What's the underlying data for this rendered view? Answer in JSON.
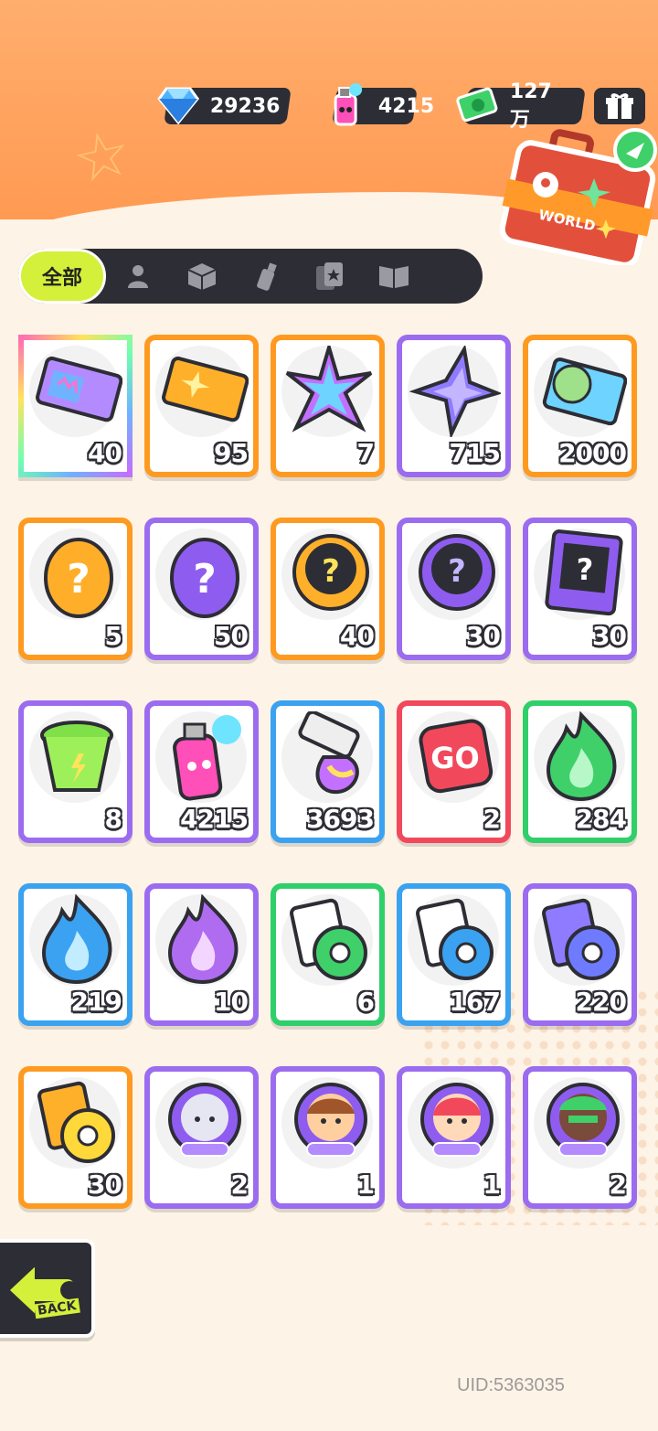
{
  "currencies": [
    {
      "icon": "diamond-icon",
      "value": "29236"
    },
    {
      "icon": "spray-can-icon",
      "value": "4215"
    },
    {
      "icon": "cash-icon",
      "value": "127万"
    }
  ],
  "world_button_label": "WORLD",
  "tabs": [
    {
      "label": "全部",
      "icon": "all",
      "active": true
    },
    {
      "label": "",
      "icon": "person-icon"
    },
    {
      "label": "",
      "icon": "box-icon"
    },
    {
      "label": "",
      "icon": "spray-icon"
    },
    {
      "label": "",
      "icon": "card-icon"
    },
    {
      "label": "",
      "icon": "book-icon"
    }
  ],
  "items": [
    {
      "name": "rainbow-ticket",
      "count": "40",
      "rarity": "rainbow"
    },
    {
      "name": "gold-ticket",
      "count": "95",
      "rarity": "orange"
    },
    {
      "name": "rainbow-star-crystal",
      "count": "7",
      "rarity": "orange"
    },
    {
      "name": "purple-star-crystal",
      "count": "715",
      "rarity": "purple"
    },
    {
      "name": "season-ticket",
      "count": "2000",
      "rarity": "orange"
    },
    {
      "name": "orange-mystery-egg",
      "count": "5",
      "rarity": "orange"
    },
    {
      "name": "purple-mystery-egg",
      "count": "50",
      "rarity": "purple"
    },
    {
      "name": "gold-deity-mystery-badge",
      "count": "40",
      "rarity": "orange"
    },
    {
      "name": "purple-deity-mystery-badge",
      "count": "30",
      "rarity": "purple"
    },
    {
      "name": "travel-mystery-card",
      "count": "30",
      "rarity": "purple"
    },
    {
      "name": "green-drink-cup",
      "count": "8",
      "rarity": "purple"
    },
    {
      "name": "spray-can",
      "count": "4215",
      "rarity": "purple"
    },
    {
      "name": "paint-tube",
      "count": "3693",
      "rarity": "blue"
    },
    {
      "name": "red-go-dice",
      "count": "2",
      "rarity": "red"
    },
    {
      "name": "green-flame",
      "count": "284",
      "rarity": "green"
    },
    {
      "name": "blue-flame",
      "count": "219",
      "rarity": "blue"
    },
    {
      "name": "purple-flame",
      "count": "10",
      "rarity": "purple"
    },
    {
      "name": "green-tape-card",
      "count": "6",
      "rarity": "green"
    },
    {
      "name": "blue-tape-card",
      "count": "167",
      "rarity": "blue"
    },
    {
      "name": "purple-tape-card",
      "count": "220",
      "rarity": "purple"
    },
    {
      "name": "gold-tape-card",
      "count": "30",
      "rarity": "orange"
    },
    {
      "name": "deity-avatar-silver",
      "count": "2",
      "rarity": "purple"
    },
    {
      "name": "deity-avatar-brown",
      "count": "1",
      "rarity": "purple"
    },
    {
      "name": "deity-avatar-red",
      "count": "1",
      "rarity": "purple"
    },
    {
      "name": "deity-avatar-green",
      "count": "2",
      "rarity": "purple"
    }
  ],
  "back_label": "BACK",
  "uid": "UID:5363035",
  "colors": {
    "accent": "#d4f03a",
    "dark": "#2d2d35",
    "orange_bg": "#ff9a52"
  }
}
